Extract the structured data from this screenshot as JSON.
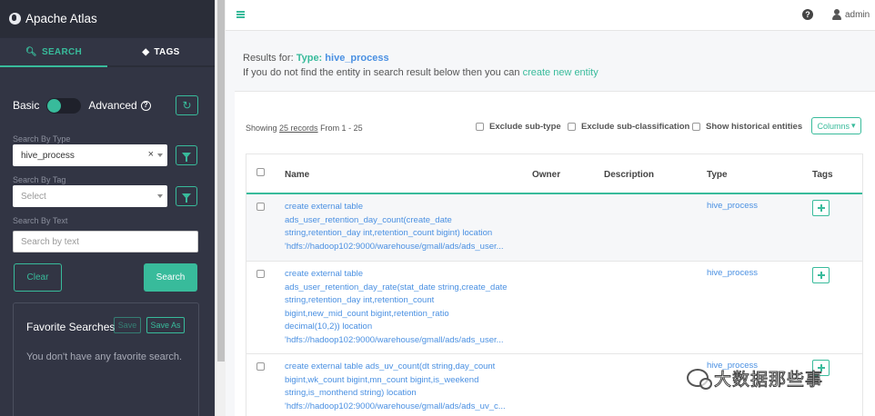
{
  "app": {
    "title": "Apache Atlas"
  },
  "sidebar": {
    "tabs": [
      {
        "label": "SEARCH"
      },
      {
        "label": "TAGS"
      }
    ],
    "mode": {
      "basic": "Basic",
      "advanced": "Advanced"
    },
    "search_by_type": {
      "label": "Search By Type",
      "value": "hive_process"
    },
    "search_by_tag": {
      "label": "Search By Tag",
      "placeholder": "Select"
    },
    "search_by_text": {
      "label": "Search By Text",
      "placeholder": "Search by text"
    },
    "buttons": {
      "clear": "Clear",
      "search": "Search"
    },
    "favorites": {
      "title": "Favorite Searches",
      "save": "Save",
      "save_as": "Save As",
      "empty": "You don't have any favorite search."
    }
  },
  "topbar": {
    "user": "admin"
  },
  "results": {
    "for_label": "Results for:",
    "type_label": "Type:",
    "type_value": "hive_process",
    "hint": "If you do not find the entity in search result below then you can ",
    "hint_link": "create new entity",
    "showing_prefix": "Showing ",
    "records_link": "25 records",
    "showing_suffix": " From 1 - 25",
    "options": [
      "Exclude sub-type",
      "Exclude sub-classification",
      "Show historical entities"
    ],
    "columns_btn": "Columns"
  },
  "table": {
    "headers": [
      "Name",
      "Owner",
      "Description",
      "Type",
      "Tags"
    ],
    "rows": [
      {
        "name_lines": [
          "create external table",
          "ads_user_retention_day_count(create_date",
          "string,retention_day int,retention_count bigint) location",
          "'hdfs://hadoop102:9000/warehouse/gmall/ads/ads_user..."
        ],
        "type": "hive_process"
      },
      {
        "name_lines": [
          "create external table",
          "ads_user_retention_day_rate(stat_date string,create_date",
          "string,retention_day int,retention_count",
          "bigint,new_mid_count bigint,retention_ratio",
          "decimal(10,2)) location",
          "'hdfs://hadoop102:9000/warehouse/gmall/ads/ads_user..."
        ],
        "type": "hive_process"
      },
      {
        "name_lines": [
          "create external table ads_uv_count(dt string,day_count",
          "bigint,wk_count bigint,mn_count bigint,is_weekend",
          "string,is_monthend string) location",
          "'hdfs://hadoop102:9000/warehouse/gmall/ads/ads_uv_c..."
        ],
        "type": "hive_process"
      }
    ]
  },
  "watermark": {
    "text": "大数据那些事"
  },
  "colors": {
    "accent": "#38bb9b",
    "sidebar": "#323544",
    "link": "#4a90e2"
  }
}
